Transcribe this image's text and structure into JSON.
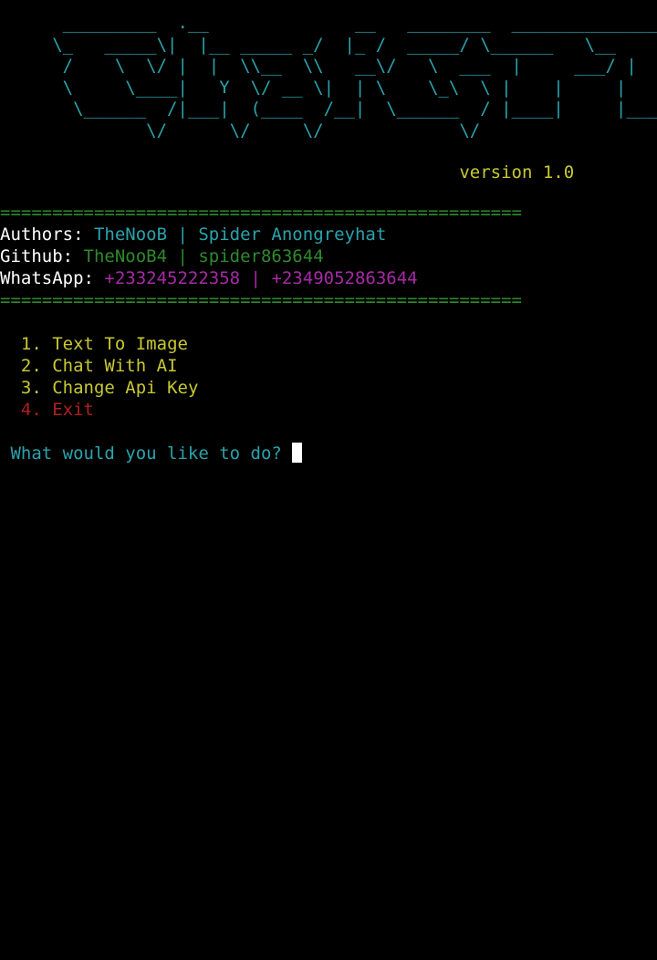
{
  "window": {
    "app_title": "ChatGPT CLI",
    "background_color": "#000000"
  },
  "banner": {
    "icon": "chatgpt-ascii-logo",
    "color": "#2aa3ac",
    "art": "      _________  .__              __   ________  __________________\n     \\_   _____\\|  |__ _____ _/  |_ /  _____/ \\______   \\__    ___/\n      /    \\  \\/ |  |  \\\\__  \\\\   __\\/   \\  ___  |     ___/ |    |   \n      \\     \\____|   Y  \\/ __ \\|  | \\    \\_\\  \\ |    |     |    |   \n       \\______  /|___|  (____  /__|  \\______  / |____|     |____|   \n              \\/      \\/     \\/             \\/                      "
  },
  "version": {
    "label": "version 1.0",
    "color": "#c8c832"
  },
  "separator": {
    "char": "=",
    "line": "==================================================",
    "color": "#2f8a2f"
  },
  "credits": {
    "authors": {
      "label": "Authors: ",
      "value_1": "TheNooB",
      "divider": " | ",
      "value_2": "Spider Anongreyhat",
      "value_color": "#2aa3ac"
    },
    "github": {
      "label": "Github: ",
      "value_1": "TheNooB4",
      "divider": " | ",
      "value_2": "spider863644",
      "value_color": "#2f8a2f"
    },
    "whatsapp": {
      "label": "WhatsApp: ",
      "value_1": "+233245222358",
      "divider": " | ",
      "value_2": "+2349052863644",
      "value_color": "#a62aa6"
    }
  },
  "menu": {
    "items": [
      {
        "number": "1.",
        "label": "Text To Image",
        "color": "#c8c832"
      },
      {
        "number": "2.",
        "label": "Chat With AI",
        "color": "#c8c832"
      },
      {
        "number": "3.",
        "label": "Change Api Key",
        "color": "#c8c832"
      },
      {
        "number": "4.",
        "label": "Exit",
        "color": "#b02020"
      }
    ]
  },
  "prompt": {
    "text": "What would you like to do? ",
    "value": "",
    "color": "#2aa3ac",
    "cursor": "block-cursor"
  }
}
